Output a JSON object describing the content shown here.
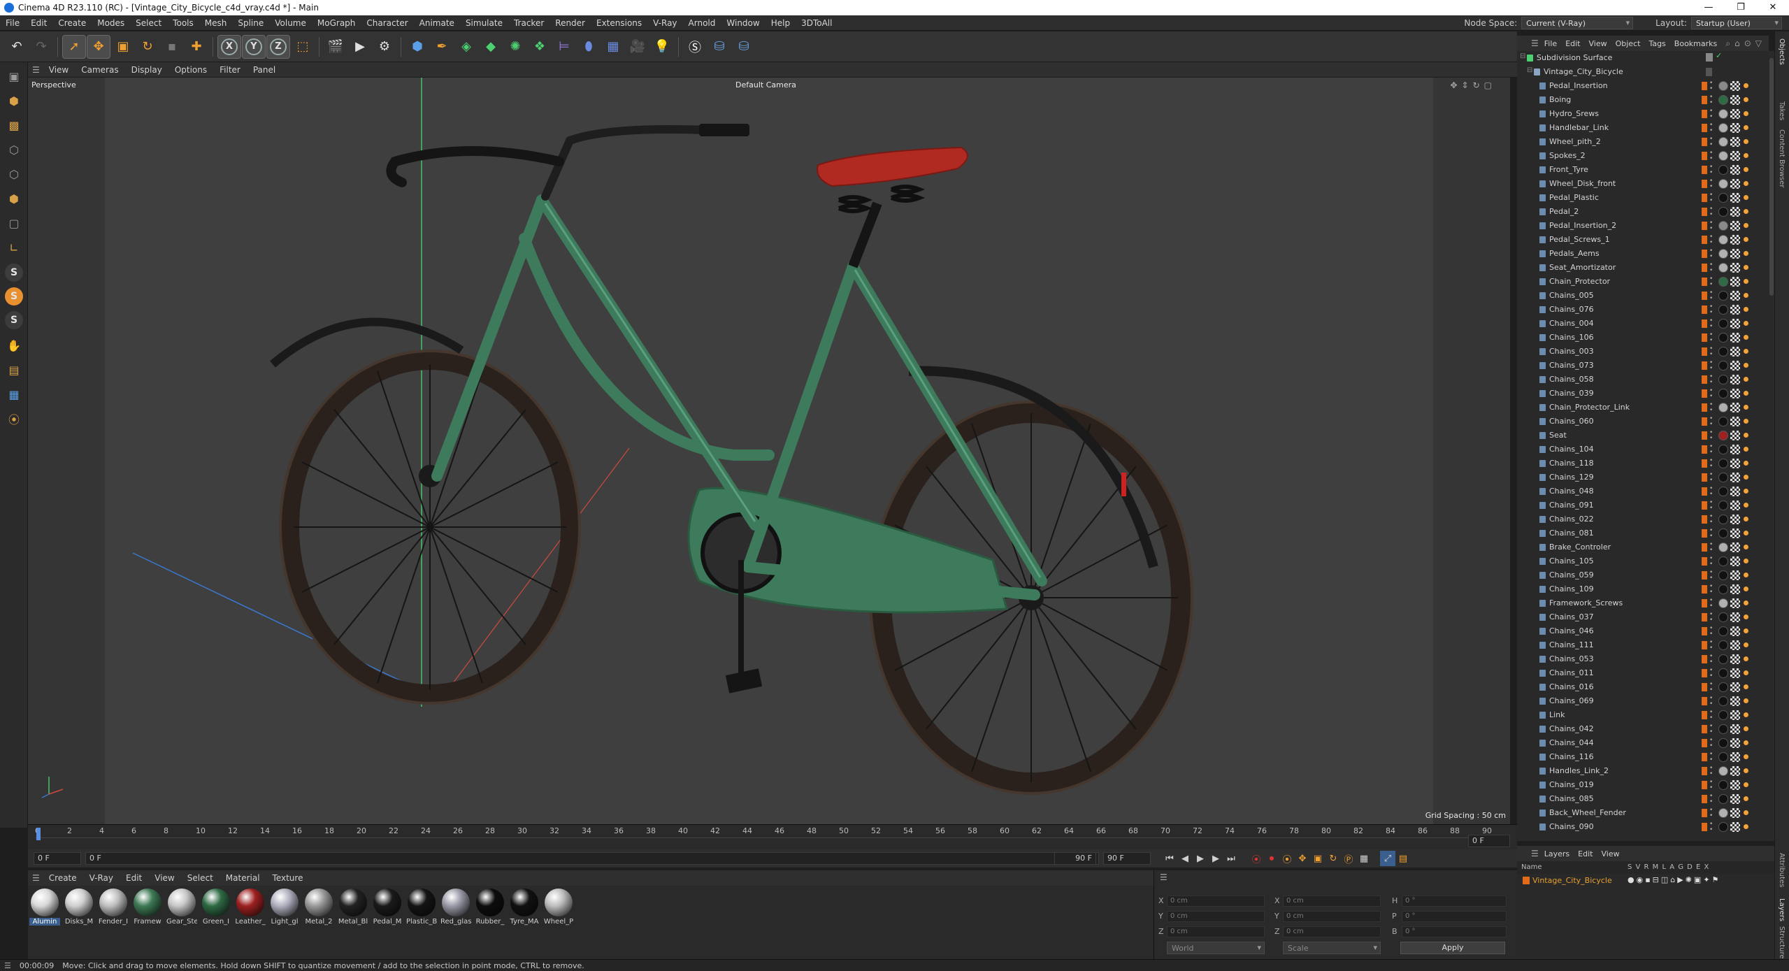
{
  "window": {
    "title": "Cinema 4D R23.110 (RC) - [Vintage_City_Bicycle_c4d_vray.c4d *] - Main",
    "controls": [
      "—",
      "❐",
      "✕"
    ]
  },
  "menubar": {
    "items": [
      "File",
      "Edit",
      "Create",
      "Modes",
      "Select",
      "Tools",
      "Mesh",
      "Spline",
      "Volume",
      "MoGraph",
      "Character",
      "Animate",
      "Simulate",
      "Tracker",
      "Render",
      "Extensions",
      "V-Ray",
      "Arnold",
      "Window",
      "Help",
      "3DToAll"
    ],
    "node_space_label": "Node Space:",
    "node_space_value": "Current (V-Ray)",
    "layout_label": "Layout:",
    "layout_value": "Startup (User)"
  },
  "toolbar": {
    "axes": [
      "X",
      "Y",
      "Z"
    ]
  },
  "viewport": {
    "menu": [
      "View",
      "Cameras",
      "Display",
      "Options",
      "Filter",
      "Panel"
    ],
    "projection": "Perspective",
    "camera": "Default Camera",
    "grid_spacing": "Grid Spacing : 50 cm",
    "colors": {
      "frame": "#3e7a5c",
      "frame_light": "#5aa07e",
      "saddle": "#b02a22",
      "tyre": "#2a211c",
      "axis_x": "#cf4a3c",
      "axis_y": "#46c46a",
      "axis_z": "#3a78d0"
    }
  },
  "timeline": {
    "ticks": [
      "0",
      "2",
      "4",
      "6",
      "8",
      "10",
      "12",
      "14",
      "16",
      "18",
      "20",
      "22",
      "24",
      "26",
      "28",
      "30",
      "32",
      "34",
      "36",
      "38",
      "40",
      "42",
      "44",
      "46",
      "48",
      "50",
      "52",
      "54",
      "56",
      "58",
      "60",
      "62",
      "64",
      "66",
      "68",
      "70",
      "72",
      "74",
      "76",
      "78",
      "80",
      "82",
      "84",
      "86",
      "88",
      "90"
    ],
    "current_frame_right": "0 F",
    "start_field": "0 F",
    "current_field": "0 F",
    "end_field": "90 F",
    "end_field_2": "90 F"
  },
  "materials": {
    "menu": [
      "Create",
      "V-Ray",
      "Edit",
      "View",
      "Select",
      "Material",
      "Texture"
    ],
    "items": [
      {
        "label": "Alumin",
        "color": "#d8d8d8",
        "selected": true
      },
      {
        "label": "Disks_M",
        "color": "#cfcfcf"
      },
      {
        "label": "Fender_I",
        "color": "#bfbfbf"
      },
      {
        "label": "Framew",
        "color": "#3d7a55"
      },
      {
        "label": "Gear_Ste",
        "color": "#c6c6c6"
      },
      {
        "label": "Green_I",
        "color": "#2f6a44"
      },
      {
        "label": "Leather_",
        "color": "#9e2020"
      },
      {
        "label": "Light_gl",
        "color": "#b0b0c0"
      },
      {
        "label": "Metal_2",
        "color": "#9a9a9a"
      },
      {
        "label": "Metal_Bl",
        "color": "#222222"
      },
      {
        "label": "Pedal_M",
        "color": "#1a1a1a"
      },
      {
        "label": "Plastic_B",
        "color": "#141414"
      },
      {
        "label": "Red_glas",
        "color": "#9a9aa8"
      },
      {
        "label": "Rubber_",
        "color": "#0d0d0d"
      },
      {
        "label": "Tyre_MA",
        "color": "#111111"
      },
      {
        "label": "Wheel_P",
        "color": "#bdbdbd"
      }
    ]
  },
  "coords": {
    "rows": [
      {
        "a": "X",
        "av": "0 cm",
        "b": "X",
        "bv": "0 cm",
        "c": "H",
        "cv": "0 °"
      },
      {
        "a": "Y",
        "av": "0 cm",
        "b": "Y",
        "bv": "0 cm",
        "c": "P",
        "cv": "0 °"
      },
      {
        "a": "Z",
        "av": "0 cm",
        "b": "Z",
        "bv": "0 cm",
        "c": "B",
        "cv": "0 °"
      }
    ],
    "mode_1": "World",
    "mode_2": "Scale",
    "apply": "Apply"
  },
  "status": {
    "time": "00:00:09",
    "message": "Move: Click and drag to move elements. Hold down SHIFT to quantize movement / add to the selection in point mode, CTRL to remove."
  },
  "objects": {
    "menu": [
      "File",
      "Edit",
      "View",
      "Object",
      "Tags",
      "Bookmarks"
    ],
    "root": "Subdivision Surface",
    "group": "Vintage_City_Bicycle",
    "items": [
      {
        "name": "Pedal_Insertion",
        "tag": "#8a8a8a"
      },
      {
        "name": "Boing",
        "tag": "#2e6a44"
      },
      {
        "name": "Hydro_Srews",
        "tag": "#b0b0b0"
      },
      {
        "name": "Handlebar_Link",
        "tag": "#b0b0b0"
      },
      {
        "name": "Wheel_pith_2",
        "tag": "#b0b0b0"
      },
      {
        "name": "Spokes_2",
        "tag": "#b0b0b0"
      },
      {
        "name": "Front_Tyre",
        "tag": "#111111"
      },
      {
        "name": "Wheel_Disk_front",
        "tag": "#b0b0b0"
      },
      {
        "name": "Pedal_Plastic",
        "tag": "#111111"
      },
      {
        "name": "Pedal_2",
        "tag": "#111111"
      },
      {
        "name": "Pedal_Insertion_2",
        "tag": "#8a8a8a"
      },
      {
        "name": "Pedal_Screws_1",
        "tag": "#b0b0b0"
      },
      {
        "name": "Pedals_Aems",
        "tag": "#b0b0b0"
      },
      {
        "name": "Seat_Amortizator",
        "tag": "#b0b0b0"
      },
      {
        "name": "Chain_Protector",
        "tag": "#2e6a44"
      },
      {
        "name": "Chains_005",
        "tag": "#111111"
      },
      {
        "name": "Chains_076",
        "tag": "#111111"
      },
      {
        "name": "Chains_004",
        "tag": "#111111"
      },
      {
        "name": "Chains_106",
        "tag": "#111111"
      },
      {
        "name": "Chains_003",
        "tag": "#111111"
      },
      {
        "name": "Chains_073",
        "tag": "#111111"
      },
      {
        "name": "Chains_058",
        "tag": "#111111"
      },
      {
        "name": "Chains_039",
        "tag": "#111111"
      },
      {
        "name": "Chain_Protector_Link",
        "tag": "#b0b0b0"
      },
      {
        "name": "Chains_060",
        "tag": "#111111"
      },
      {
        "name": "Seat",
        "tag": "#9e2020"
      },
      {
        "name": "Chains_104",
        "tag": "#111111"
      },
      {
        "name": "Chains_118",
        "tag": "#111111"
      },
      {
        "name": "Chains_129",
        "tag": "#111111"
      },
      {
        "name": "Chains_048",
        "tag": "#111111"
      },
      {
        "name": "Chains_091",
        "tag": "#111111"
      },
      {
        "name": "Chains_022",
        "tag": "#111111"
      },
      {
        "name": "Chains_081",
        "tag": "#111111"
      },
      {
        "name": "Brake_Controler",
        "tag": "#b0b0b0"
      },
      {
        "name": "Chains_105",
        "tag": "#111111"
      },
      {
        "name": "Chains_059",
        "tag": "#111111"
      },
      {
        "name": "Chains_109",
        "tag": "#111111"
      },
      {
        "name": "Framework_Screws",
        "tag": "#b0b0b0"
      },
      {
        "name": "Chains_037",
        "tag": "#111111"
      },
      {
        "name": "Chains_046",
        "tag": "#111111"
      },
      {
        "name": "Chains_111",
        "tag": "#111111"
      },
      {
        "name": "Chains_053",
        "tag": "#111111"
      },
      {
        "name": "Chains_011",
        "tag": "#111111"
      },
      {
        "name": "Chains_016",
        "tag": "#111111"
      },
      {
        "name": "Chains_069",
        "tag": "#111111"
      },
      {
        "name": "Link",
        "tag": "#111111"
      },
      {
        "name": "Chains_042",
        "tag": "#111111"
      },
      {
        "name": "Chains_044",
        "tag": "#111111"
      },
      {
        "name": "Chains_116",
        "tag": "#111111"
      },
      {
        "name": "Handles_Link_2",
        "tag": "#b0b0b0"
      },
      {
        "name": "Chains_019",
        "tag": "#111111"
      },
      {
        "name": "Chains_085",
        "tag": "#111111"
      },
      {
        "name": "Back_Wheel_Fender",
        "tag": "#b0b0b0"
      },
      {
        "name": "Chains_090",
        "tag": "#111111"
      }
    ]
  },
  "layers": {
    "menu": [
      "Layers",
      "Edit",
      "View"
    ],
    "header_name": "Name",
    "header_flags": "S V R M L A G D E X",
    "row": "Vintage_City_Bicycle"
  },
  "side_tabs": [
    "Objects",
    "Takes",
    "Content Browser",
    "Attributes",
    "Layers",
    "Structure"
  ]
}
